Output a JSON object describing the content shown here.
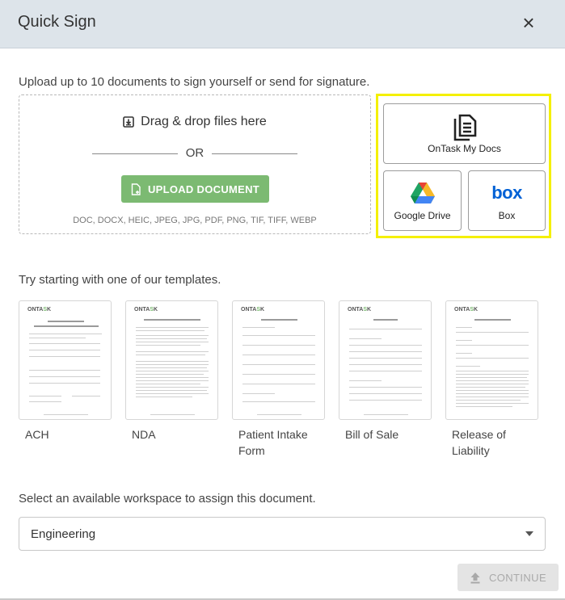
{
  "dialog": {
    "title": "Quick Sign",
    "close_label": "×"
  },
  "upload": {
    "intro": "Upload up to 10 documents to sign yourself or send for signature.",
    "drag_drop": "Drag & drop files here",
    "or": "OR",
    "button": "UPLOAD DOCUMENT",
    "types": "DOC, DOCX, HEIC, JPEG, JPG, PDF, PNG, TIF, TIFF, WEBP"
  },
  "sources": [
    {
      "label": "OnTask My Docs",
      "icon": "documents-icon"
    },
    {
      "label": "Google Drive",
      "icon": "google-drive-icon"
    },
    {
      "label": "Box",
      "icon": "box-logo-icon",
      "logo_text": "box"
    }
  ],
  "templates": {
    "heading": "Try starting with one of our templates.",
    "logo_text": "ONTASK",
    "items": [
      {
        "label": "ACH"
      },
      {
        "label": "NDA"
      },
      {
        "label": "Patient Intake Form"
      },
      {
        "label": "Bill of Sale"
      },
      {
        "label": "Release of Liability"
      }
    ]
  },
  "workspace": {
    "prompt": "Select an available workspace to assign this document.",
    "selected": "Engineering"
  },
  "footer": {
    "continue": "CONTINUE"
  },
  "colors": {
    "header_bg": "#dde4ea",
    "upload_green": "#7cba72",
    "highlight": "#f4f000",
    "disabled_bg": "#e4e4e4"
  }
}
